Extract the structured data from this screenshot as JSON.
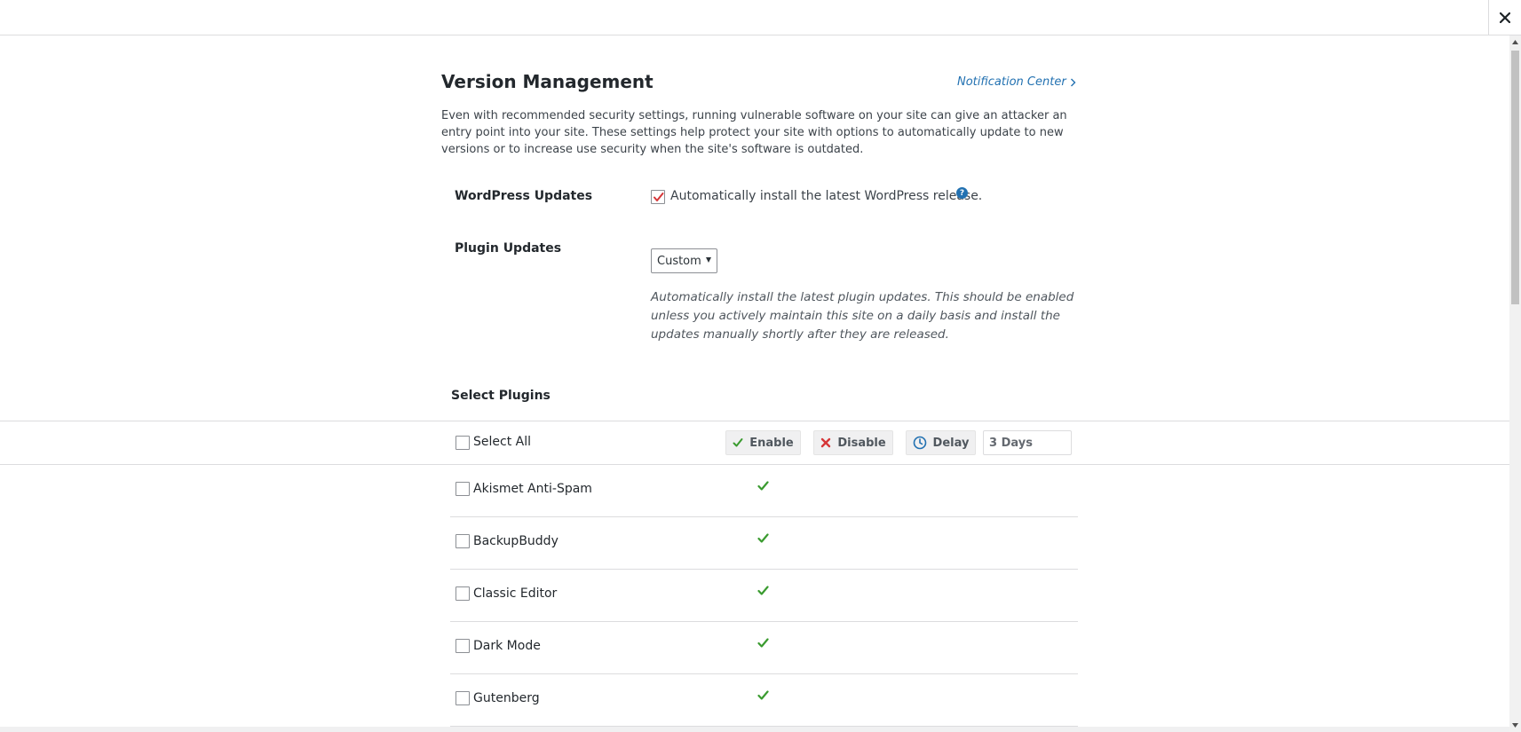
{
  "header": {
    "title": "Version Management",
    "notification_link": "Notification Center"
  },
  "intro": "Even with recommended security settings, running vulnerable software on your site can give an attacker an entry point into your site. These settings help protect your site with options to automatically update to new versions or to increase use security when the site's software is outdated.",
  "wordpress_updates": {
    "label": "WordPress Updates",
    "checkbox_text": "Automatically install the latest WordPress release.",
    "checked": true,
    "help_glyph": "?"
  },
  "plugin_updates": {
    "label": "Plugin Updates",
    "selected": "Custom",
    "description": "Automatically install the latest plugin updates. This should be enabled unless you actively maintain this site on a daily basis and install the updates manually shortly after they are released."
  },
  "select_plugins": {
    "heading": "Select Plugins",
    "select_all_label": "Select All",
    "enable_label": "Enable",
    "disable_label": "Disable",
    "delay_label": "Delay",
    "delay_value": "3 Days",
    "plugins": [
      {
        "name": "Akismet Anti-Spam",
        "status": "enabled"
      },
      {
        "name": "BackupBuddy",
        "status": "enabled"
      },
      {
        "name": "Classic Editor",
        "status": "enabled"
      },
      {
        "name": "Dark Mode",
        "status": "enabled"
      },
      {
        "name": "Gutenberg",
        "status": "enabled"
      }
    ]
  },
  "colors": {
    "accent": "#2271b1",
    "check_green": "#3a9b2f",
    "disable_red": "#d63638"
  },
  "icons": {
    "close": "close-icon",
    "notification_chevron": "chevron-right-icon",
    "enable": "checkmark-icon",
    "disable": "x-icon",
    "delay": "clock-icon"
  }
}
